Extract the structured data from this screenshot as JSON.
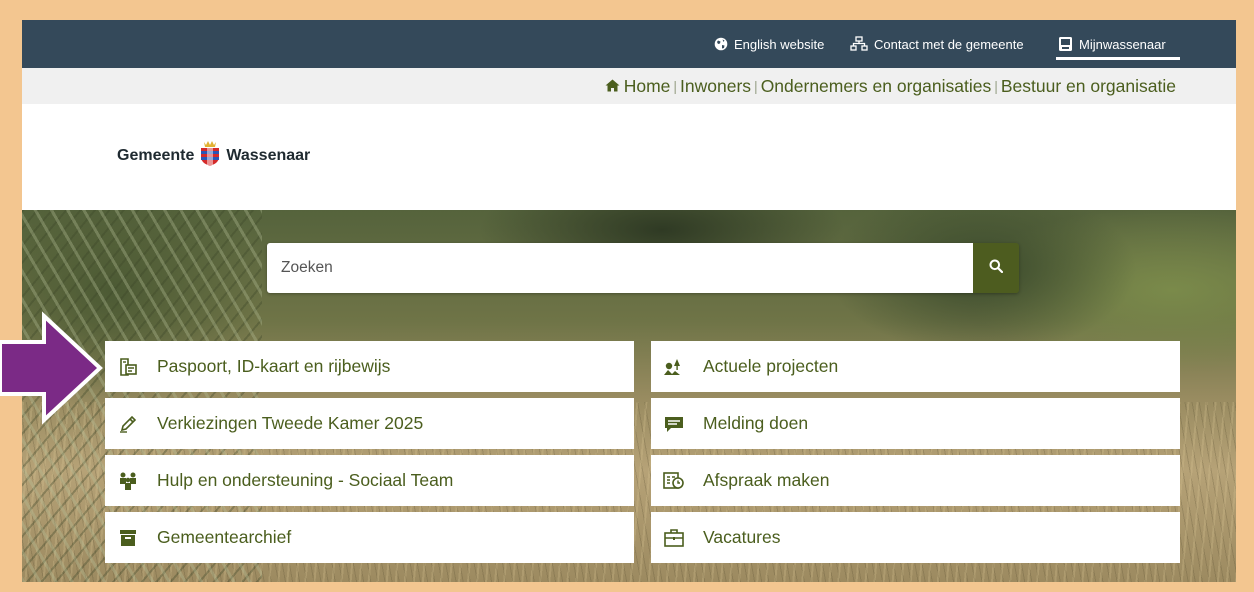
{
  "topbar": {
    "english": "English website",
    "contact": "Contact met de gemeente",
    "mijn": "Mijnwassenaar"
  },
  "nav": {
    "home": "Home",
    "inwoners": "Inwoners",
    "ondernemers": "Ondernemers en organisaties",
    "bestuur": "Bestuur en organisatie"
  },
  "logo": {
    "left": "Gemeente",
    "right": "Wassenaar"
  },
  "search": {
    "placeholder": "Zoeken"
  },
  "tiles": [
    {
      "label": "Paspoort, ID-kaart en rijbewijs",
      "icon": "id-card-icon"
    },
    {
      "label": "Actuele projecten",
      "icon": "projects-icon"
    },
    {
      "label": "Verkiezingen Tweede Kamer 2025",
      "icon": "pencil-icon"
    },
    {
      "label": "Melding doen",
      "icon": "message-icon"
    },
    {
      "label": "Hulp en ondersteuning - Sociaal Team",
      "icon": "people-icon"
    },
    {
      "label": "Afspraak maken",
      "icon": "calendar-clock-icon"
    },
    {
      "label": "Gemeentearchief",
      "icon": "archive-icon"
    },
    {
      "label": "Vacatures",
      "icon": "briefcase-icon"
    }
  ],
  "colors": {
    "frame": "#f3c690",
    "topbar": "#34495a",
    "accent": "#4d5c1f",
    "link": "#4b5e1e",
    "arrow": "#7b2a86"
  }
}
